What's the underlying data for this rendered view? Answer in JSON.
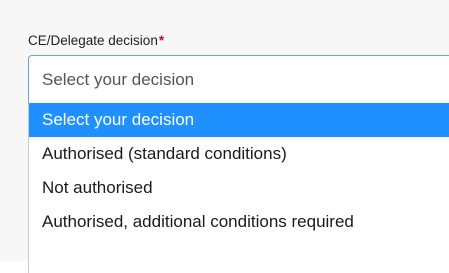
{
  "field": {
    "label": "CE/Delegate decision",
    "required_marker": "*",
    "selected_value": "Select your decision"
  },
  "dropdown": {
    "options": [
      {
        "label": "Select your decision",
        "highlighted": true
      },
      {
        "label": "Authorised (standard conditions)",
        "highlighted": false
      },
      {
        "label": "Not authorised",
        "highlighted": false
      },
      {
        "label": "Authorised, additional conditions required",
        "highlighted": false
      }
    ]
  },
  "colors": {
    "highlight": "#1e90ff",
    "required": "#d0021b",
    "focus_border": "#6aa0e8"
  }
}
